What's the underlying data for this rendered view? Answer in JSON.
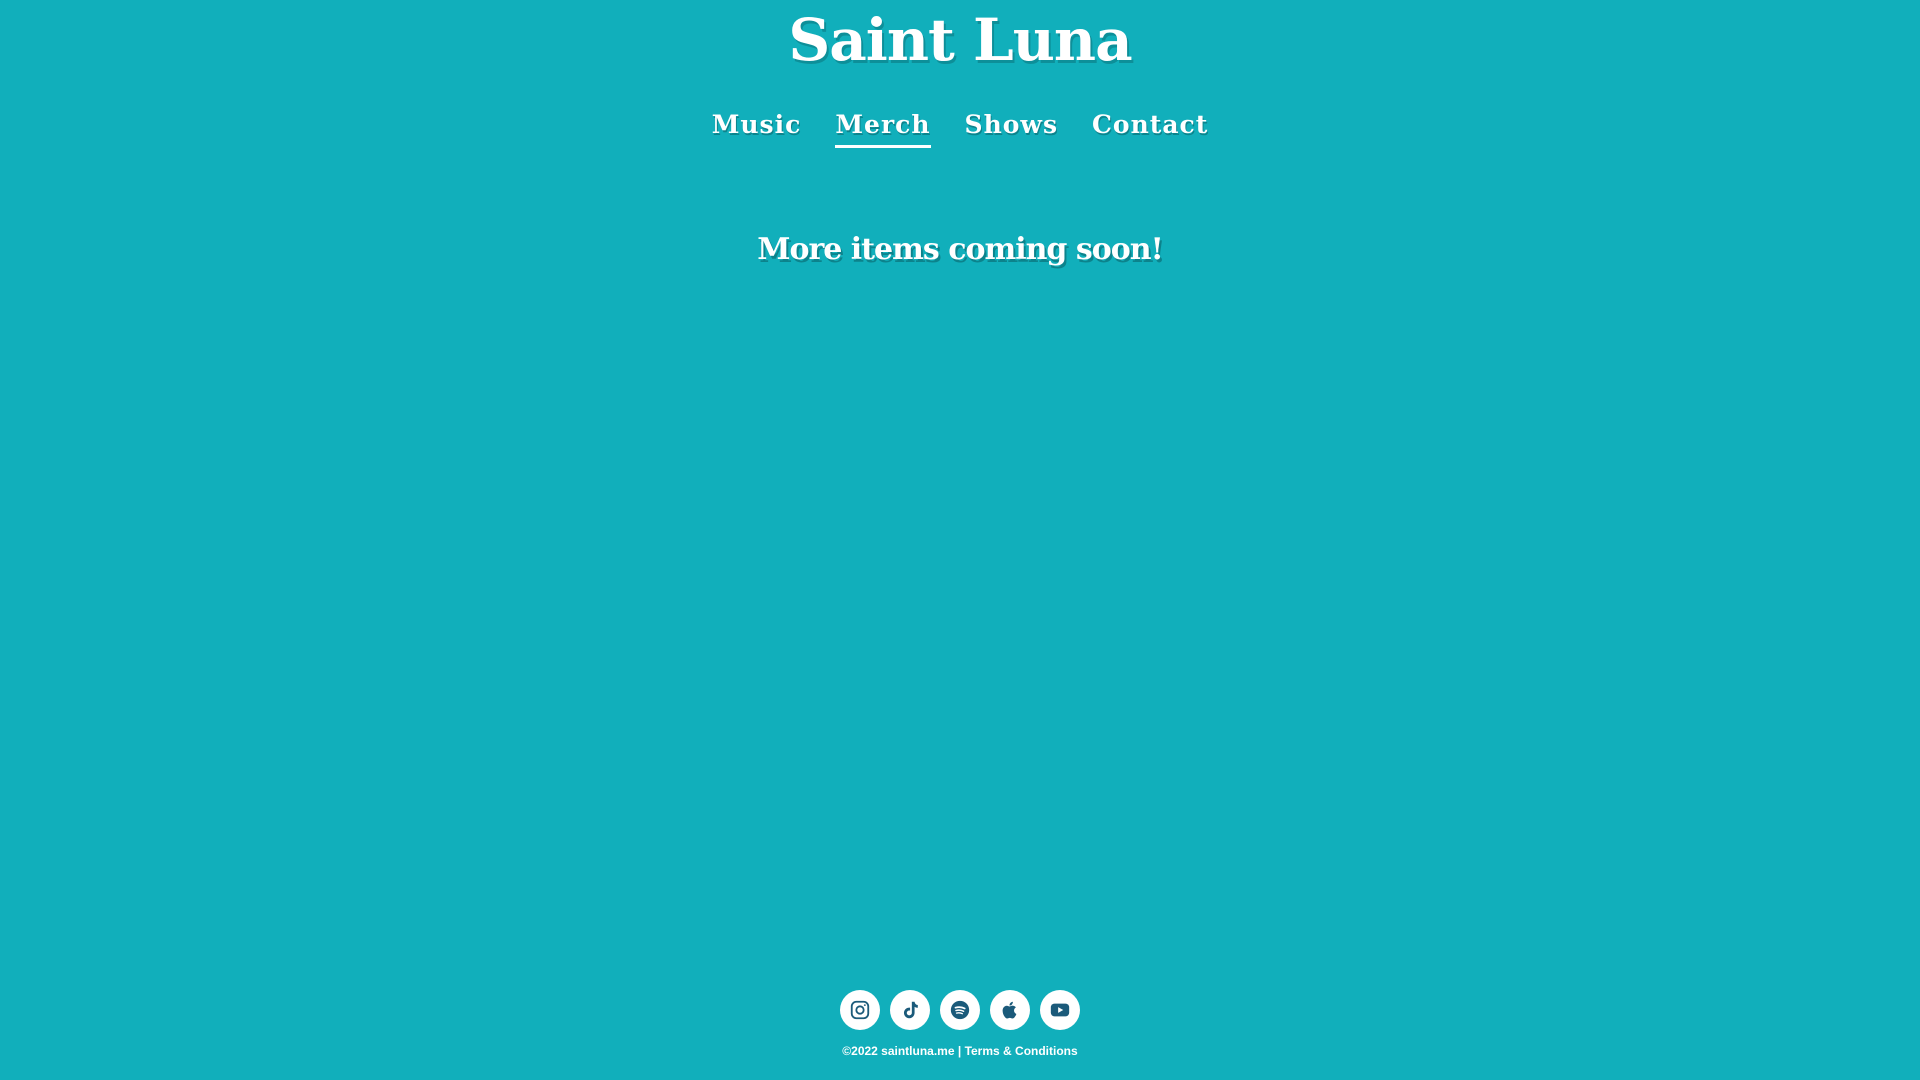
{
  "site": {
    "title": "Saint Luna"
  },
  "nav": {
    "items": [
      {
        "label": "Music"
      },
      {
        "label": "Merch"
      },
      {
        "label": "Shows"
      },
      {
        "label": "Contact"
      }
    ],
    "active": "Merch"
  },
  "main": {
    "notice": "More items coming soon!"
  },
  "social": {
    "icons": [
      "instagram-icon",
      "tiktok-icon",
      "spotify-icon",
      "apple-icon",
      "youtube-icon"
    ],
    "icon_color": "#1b5a7a"
  },
  "footer": {
    "copyright": "©2022 saintluna.me",
    "separator": " | ",
    "terms_label": "Terms & Conditions"
  },
  "colors": {
    "background": "#11afbb",
    "text": "#ffffff"
  }
}
